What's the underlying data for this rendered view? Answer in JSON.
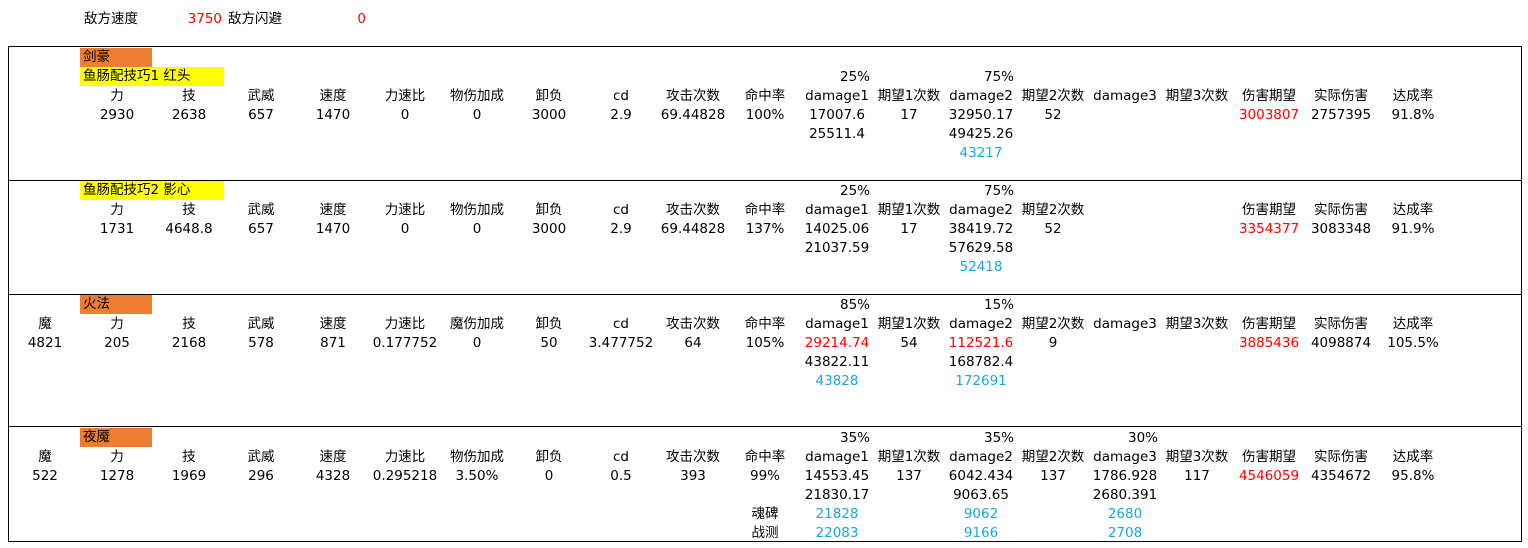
{
  "top": {
    "speed_label": "敌方速度",
    "speed_value": "3750",
    "evade_label": "敌方闪避",
    "evade_value": "0"
  },
  "headers": {
    "mo": "魔",
    "li": "力",
    "ji": "技",
    "wuwei": "武威",
    "sudu": "速度",
    "lisubi": "力速比",
    "wushang": "物伤加成",
    "moshang": "魔伤加成",
    "xiefu": "卸负",
    "cd": "cd",
    "gongji": "攻击次数",
    "mingzhong": "命中率",
    "dmg1": "damage1",
    "exp1": "期望1次数",
    "dmg2": "damage2",
    "exp2": "期望2次数",
    "dmg3": "damage3",
    "exp3": "期望3次数",
    "shanghai": "伤害期望",
    "shiji": "实际伤害",
    "dacheng": "达成率"
  },
  "b1": {
    "class_label": "剑豪",
    "setup_label": "鱼肠配技巧1 红头",
    "pct1": "25%",
    "pct2": "75%",
    "li": "2930",
    "ji": "2638",
    "wuwei": "657",
    "sudu": "1470",
    "lisubi": "0",
    "wushang": "0",
    "xiefu": "3000",
    "cd": "2.9",
    "gongji": "69.44828",
    "mingzhong": "100%",
    "d1a": "17007.6",
    "d1b": "25511.4",
    "e1": "17",
    "d2a": "32950.17",
    "d2b": "49425.26",
    "d2c": "43217",
    "e2": "52",
    "shanghai": "3003807",
    "shiji": "2757395",
    "dacheng": "91.8%"
  },
  "b2": {
    "setup_label": "鱼肠配技巧2 影心",
    "pct1": "25%",
    "pct2": "75%",
    "li": "1731",
    "ji": "4648.8",
    "wuwei": "657",
    "sudu": "1470",
    "lisubi": "0",
    "wushang": "0",
    "xiefu": "3000",
    "cd": "2.9",
    "gongji": "69.44828",
    "mingzhong": "137%",
    "d1a": "14025.06",
    "d1b": "21037.59",
    "e1": "17",
    "d2a": "38419.72",
    "d2b": "57629.58",
    "d2c": "52418",
    "e2": "52",
    "shanghai": "3354377",
    "shiji": "3083348",
    "dacheng": "91.9%"
  },
  "b3": {
    "class_label": "火法",
    "pct1": "85%",
    "pct2": "15%",
    "mo": "4821",
    "li": "205",
    "ji": "2168",
    "wuwei": "578",
    "sudu": "871",
    "lisubi": "0.177752",
    "moshang": "0",
    "xiefu": "50",
    "cd": "3.477752",
    "gongji": "64",
    "mingzhong": "105%",
    "d1a": "29214.74",
    "d1b": "43822.11",
    "d1c": "43828",
    "e1": "54",
    "d2a": "112521.6",
    "d2b": "168782.4",
    "d2c": "172691",
    "e2": "9",
    "shanghai": "3885436",
    "shiji": "4098874",
    "dacheng": "105.5%"
  },
  "b4": {
    "class_label": "夜魇",
    "pct1": "35%",
    "pct2": "35%",
    "pct3": "30%",
    "mo": "522",
    "li": "1278",
    "ji": "1969",
    "wuwei": "296",
    "sudu": "4328",
    "lisubi": "0.295218",
    "wushang": "3.50%",
    "xiefu": "0",
    "cd": "0.5",
    "gongji": "393",
    "mingzhong": "99%",
    "d1a": "14553.45",
    "d1b": "21830.17",
    "d1c": "21828",
    "d1d": "22083",
    "e1": "137",
    "d2a": "6042.434",
    "d2b": "9063.65",
    "d2c": "9062",
    "d2d": "9166",
    "e2": "137",
    "d3a": "1786.928",
    "d3b": "2680.391",
    "d3c": "2680",
    "d3d": "2708",
    "e3": "117",
    "shanghai": "4546059",
    "shiji": "4354672",
    "dacheng": "95.8%",
    "row_hunbei": "魂碑",
    "row_zhance": "战测"
  }
}
